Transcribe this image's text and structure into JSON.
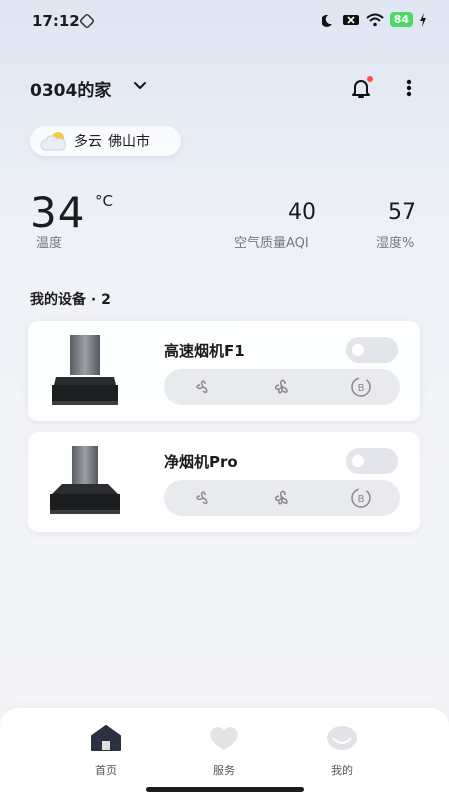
{
  "status_bar": {
    "time": "17:12",
    "battery": "84"
  },
  "header": {
    "home_name": "0304的家"
  },
  "weather": {
    "condition": "多云",
    "city": "佛山市"
  },
  "stats": {
    "temperature": "34",
    "temperature_unit": "°C",
    "temperature_label": "温度",
    "aqi": "40",
    "aqi_label": "空气质量AQI",
    "humidity": "57",
    "humidity_label": "湿度%"
  },
  "devices": {
    "title": "我的设备 · 2",
    "items": [
      {
        "name": "高速烟机F1"
      },
      {
        "name": "净烟机Pro"
      }
    ]
  },
  "tabbar": {
    "items": [
      {
        "label": "首页"
      },
      {
        "label": "服务"
      },
      {
        "label": "我的"
      }
    ]
  }
}
